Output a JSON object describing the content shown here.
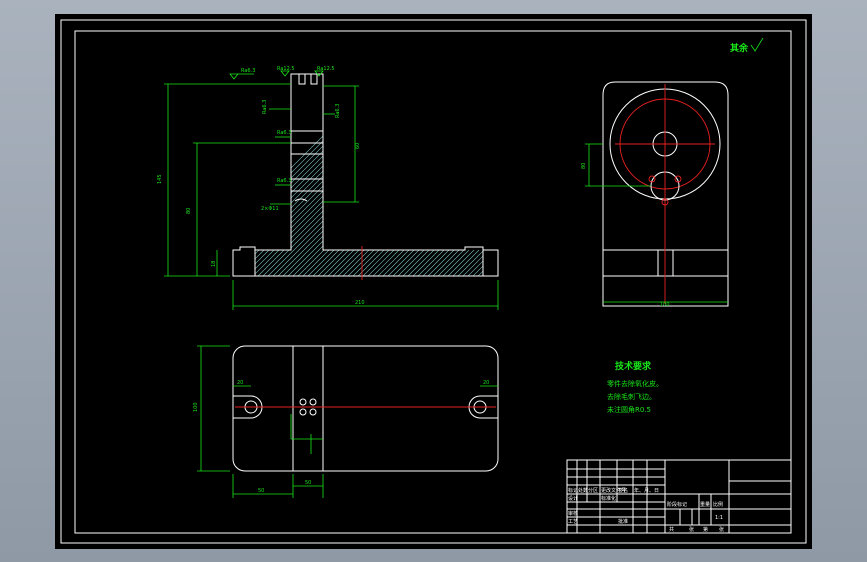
{
  "colors": {
    "paper": "#000000",
    "outline": "#ffffff",
    "dimension": "#19e619",
    "centerline": "#e62020",
    "hatch": "#7ec3c3",
    "window": "#9aa4b0"
  },
  "surface_mark": "其余",
  "tech_requirements": {
    "title": "技术要求",
    "items": [
      "零件去除氧化皮。",
      "去除毛刺飞边。",
      "未注圆角R0.5"
    ]
  },
  "dims": {
    "front_overall_width": "210",
    "front_overall_height": "145",
    "front_mid_height": "80",
    "front_base_height": "18",
    "front_slot_depth": "60",
    "side_width": "100",
    "side_height": "80",
    "top_height": "100",
    "top_left_offset": "50",
    "top_right_offset": "50",
    "hole_left": "20",
    "hole_right": "20",
    "rough_mark": "Ra6.3",
    "rough_mark_2": "Ra12.5",
    "hole_callout": "2×Φ11"
  },
  "title_block": {
    "row1": [
      "标记",
      "处数",
      "分区",
      "更改文件号",
      "签名",
      "年、月、日"
    ],
    "design": "设计",
    "standard": "标准化",
    "review": "审核",
    "process": "工艺",
    "approve": "批准",
    "stage_mark": "阶段标记",
    "weight": "重量",
    "scale": "比例",
    "scale_value": "1:1",
    "sheets": "共",
    "sheet_of": "张",
    "sheet": "第",
    "sheet_end": "张"
  }
}
